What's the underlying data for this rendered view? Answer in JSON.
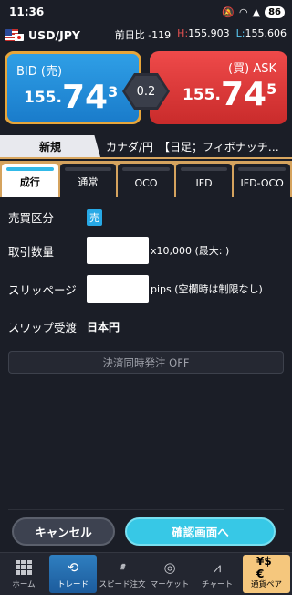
{
  "status": {
    "time": "11:36",
    "battery": "86"
  },
  "quote": {
    "pair": "USD/JPY",
    "change_label": "前日比",
    "change_value": "-119",
    "high_label": "H:",
    "high_value": "155.903",
    "low_label": "L:",
    "low_value": "155.606"
  },
  "bid": {
    "label": "BID (売)",
    "price_main": "155.",
    "price_big": "74",
    "price_small": "3"
  },
  "ask": {
    "label": "(買) ASK",
    "price_main": "155.",
    "price_big": "74",
    "price_small": "5"
  },
  "spread": "0.2",
  "tabs": {
    "active": "新規",
    "other": "カナダ/円　【日足；フィボナッチ…"
  },
  "order_types": [
    "成行",
    "通常",
    "OCO",
    "IFD",
    "IFD-OCO"
  ],
  "form": {
    "side_label": "売買区分",
    "side_value": "売",
    "qty_label": "取引数量",
    "qty_unit": "x10,000 (最大:   )",
    "slip_label": "スリッページ",
    "slip_unit": "pips (空欄時は制限なし)",
    "swap_label": "スワップ受渡",
    "swap_value": "日本円",
    "settle_button": "決済同時発注 OFF"
  },
  "actions": {
    "cancel": "キャンセル",
    "confirm": "確認画面へ"
  },
  "nav": [
    {
      "label": "ホーム",
      "icon": "grid-icon"
    },
    {
      "label": "トレード",
      "icon": "refresh-icon"
    },
    {
      "label": "スピード注文",
      "icon": "speed-icon"
    },
    {
      "label": "マーケット",
      "icon": "globe-icon"
    },
    {
      "label": "チャート",
      "icon": "chart-icon"
    },
    {
      "label": "通貨ペア",
      "icon": "currency-icon"
    }
  ]
}
